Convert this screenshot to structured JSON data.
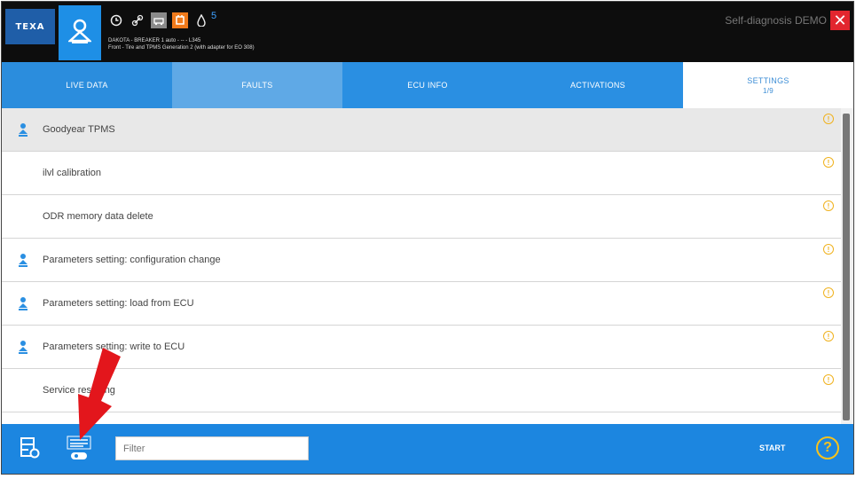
{
  "header": {
    "logo_text": "TEXA",
    "vehicle_line1": "DAKOTA - BREAKER 1 auto - -- - L345",
    "vehicle_line2": "Front - Tire and TPMS Generation 2 (with adapter for EO 308)",
    "notification_count": "5",
    "demo_label": "Self-diagnosis DEMO",
    "close_symbol": "✕"
  },
  "tabs": [
    {
      "label": "LIVE DATA",
      "sub": ""
    },
    {
      "label": "FAULTS",
      "sub": ""
    },
    {
      "label": "ECU INFO",
      "sub": ""
    },
    {
      "label": "ACTIVATIONS",
      "sub": ""
    },
    {
      "label": "SETTINGS",
      "sub": "1/9"
    }
  ],
  "list": {
    "items": [
      {
        "label": "Goodyear TPMS",
        "has_device_icon": true,
        "selected": true
      },
      {
        "label": "ilvl calibration",
        "has_device_icon": false,
        "selected": false
      },
      {
        "label": "ODR memory data delete",
        "has_device_icon": false,
        "selected": false
      },
      {
        "label": "Parameters setting: configuration change",
        "has_device_icon": true,
        "selected": false
      },
      {
        "label": "Parameters setting: load from ECU",
        "has_device_icon": true,
        "selected": false
      },
      {
        "label": "Parameters setting: write to ECU",
        "has_device_icon": true,
        "selected": false
      },
      {
        "label": "Service resetting",
        "has_device_icon": false,
        "selected": false
      }
    ],
    "info_symbol": "!"
  },
  "bottom": {
    "filter_placeholder": "Filter",
    "start_label": "START",
    "help_symbol": "?"
  },
  "colors": {
    "accent": "#1c86e0",
    "close": "#e2262e",
    "warning": "#f0b21e",
    "annotation_arrow": "#e3161c"
  },
  "icons": [
    "user-icon",
    "clock-icon",
    "link-icon",
    "car-icon",
    "connector-icon",
    "drop-icon",
    "device-icon",
    "info-icon",
    "report-icon",
    "remote-support-icon",
    "help-icon",
    "close-icon"
  ]
}
